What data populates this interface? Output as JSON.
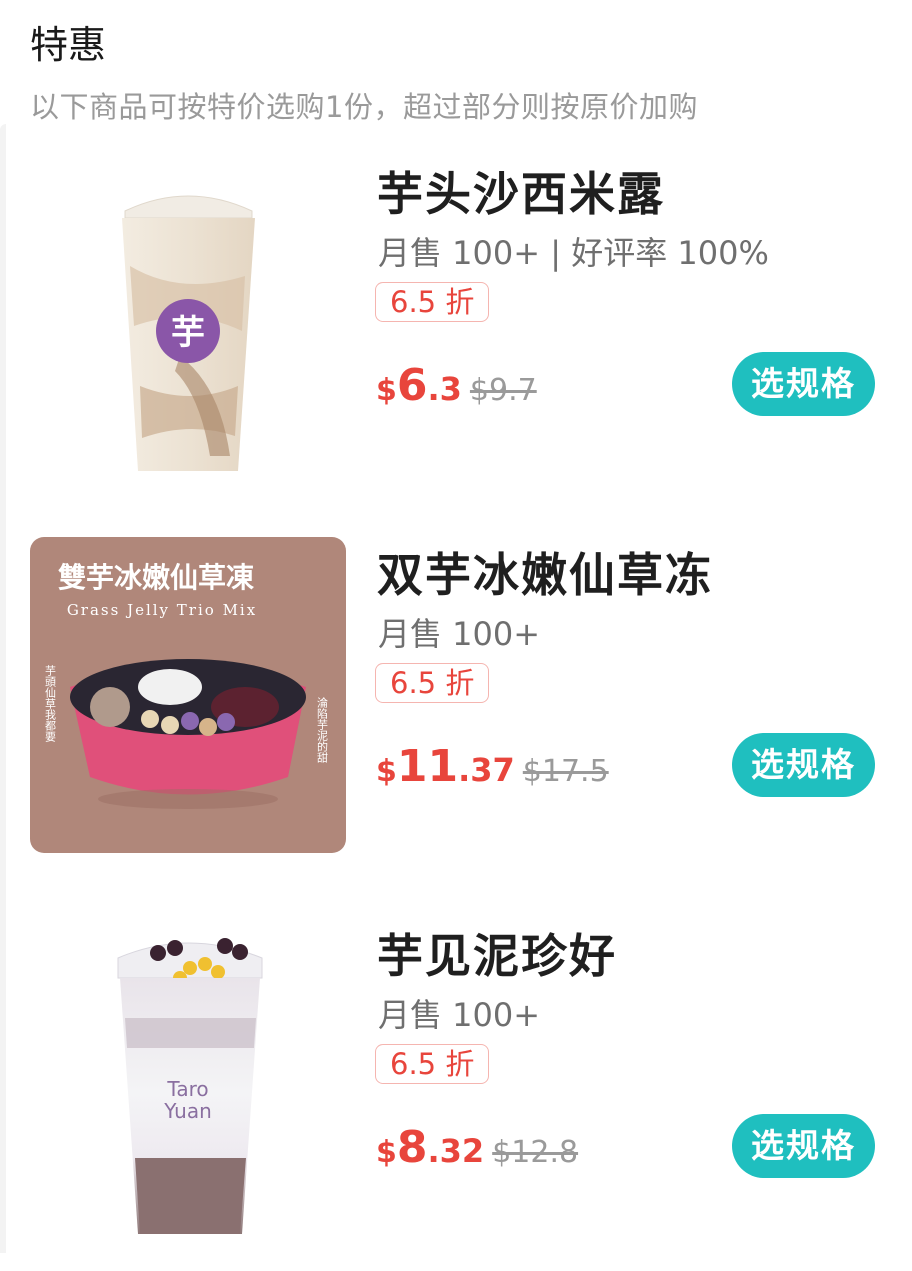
{
  "section": {
    "title": "特惠",
    "subtitle": "以下商品可按特价选购1份，超过部分则按原价加购"
  },
  "products": [
    {
      "name": "芋头沙西米露",
      "sales": "月售 100+ | 好评率 100%",
      "discount": "6.5 折",
      "currency": "$",
      "price_int": "6",
      "price_dec": ".3",
      "original_price": "$9.7",
      "button": "选规格",
      "image_text": {
        "logo": "芋"
      }
    },
    {
      "name": "双芋冰嫩仙草冻",
      "sales": "月售 100+",
      "discount": "6.5 折",
      "currency": "$",
      "price_int": "11",
      "price_dec": ".37",
      "original_price": "$17.5",
      "button": "选规格",
      "image_text": {
        "title_cn": "雙芋冰嫩仙草凍",
        "title_en": "Grass Jelly Trio Mix",
        "side_left": "芋頭仙草我都要",
        "side_right": "淪陷芋泥的甜"
      }
    },
    {
      "name": "芋见泥珍好",
      "sales": "月售 100+",
      "discount": "6.5 折",
      "currency": "$",
      "price_int": "8",
      "price_dec": ".32",
      "original_price": "$12.8",
      "button": "选规格",
      "image_text": {
        "cup_line1": "Taro",
        "cup_line2": "Yuan"
      }
    }
  ],
  "colors": {
    "accent": "#1fbfbf",
    "price": "#e8453c",
    "badge_border": "#f5b5b0"
  }
}
